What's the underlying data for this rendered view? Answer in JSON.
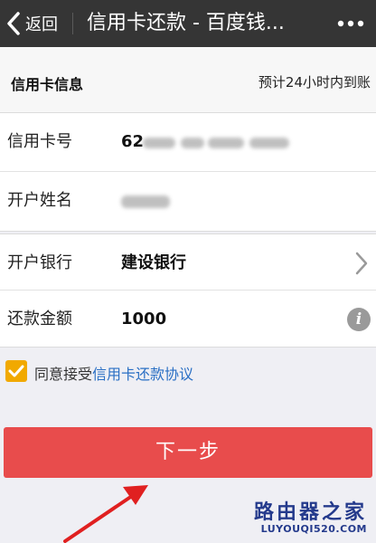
{
  "header": {
    "back_label": "返回",
    "title": "信用卡还款 - 百度钱..."
  },
  "section": {
    "title": "信用卡信息",
    "note": "预计24小时内到账"
  },
  "form": {
    "card_number": {
      "label": "信用卡号",
      "value": "62"
    },
    "name": {
      "label": "开户姓名"
    },
    "bank": {
      "label": "开户银行",
      "value": "建设银行"
    },
    "amount": {
      "label": "还款金额",
      "value": "1000"
    }
  },
  "agreement": {
    "checked": true,
    "text": "同意接受",
    "link": "信用卡还款协议"
  },
  "next_button": {
    "label": "下一步"
  },
  "watermark": {
    "title": "路由器之家",
    "url": "LUYOUQI520.COM"
  },
  "colors": {
    "topbar": "#353535",
    "accent_red": "#e84c4c",
    "checkbox": "#f1a900",
    "link": "#2a6fc4",
    "watermark": "#243a8c"
  },
  "icons": {
    "back": "chevron-left-icon",
    "more": "more-dots-icon",
    "bank_select": "chevron-right-icon",
    "amount_info": "info-icon",
    "agreement": "checkbox-checked-icon"
  }
}
